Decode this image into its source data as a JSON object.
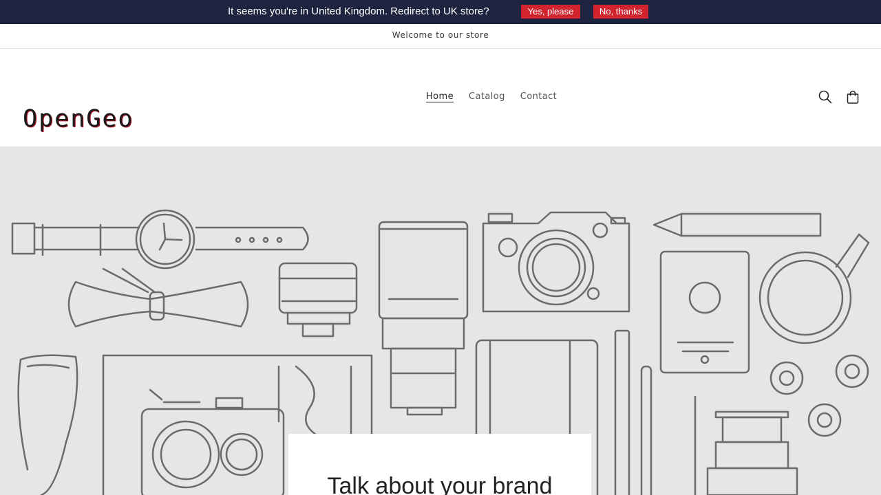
{
  "geo_banner": {
    "message": "It seems you're in United Kingdom. Redirect to UK store?",
    "yes_label": "Yes, please",
    "no_label": "No, thanks",
    "background": "#1e2340",
    "button_color": "#d1242f"
  },
  "announcement": {
    "text": "Welcome to our store"
  },
  "header": {
    "logo": "OpenGeo",
    "nav": [
      {
        "label": "Home",
        "active": true
      },
      {
        "label": "Catalog",
        "active": false
      },
      {
        "label": "Contact",
        "active": false
      }
    ],
    "icons": {
      "search": "search-icon",
      "cart": "cart-icon"
    }
  },
  "hero": {
    "title": "Talk about your brand",
    "background": "#e6e6e6"
  }
}
